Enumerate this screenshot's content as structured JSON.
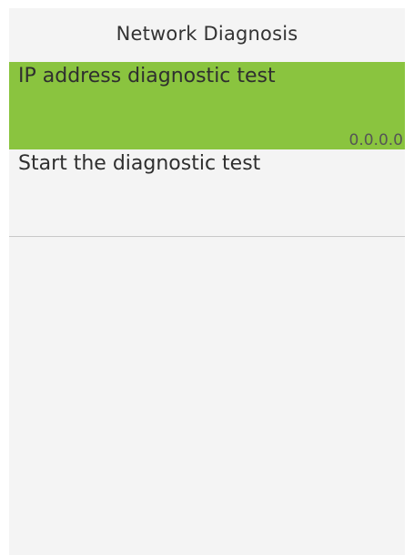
{
  "header": {
    "title": "Network Diagnosis"
  },
  "menu": {
    "items": [
      {
        "label": "IP address diagnostic test",
        "value": "0.0.0.0",
        "selected": true
      },
      {
        "label": "Start the diagnostic test",
        "value": "",
        "selected": false
      }
    ]
  },
  "colors": {
    "highlight": "#8ac43f",
    "background": "#f4f4f4",
    "text": "#2f2f2f"
  }
}
